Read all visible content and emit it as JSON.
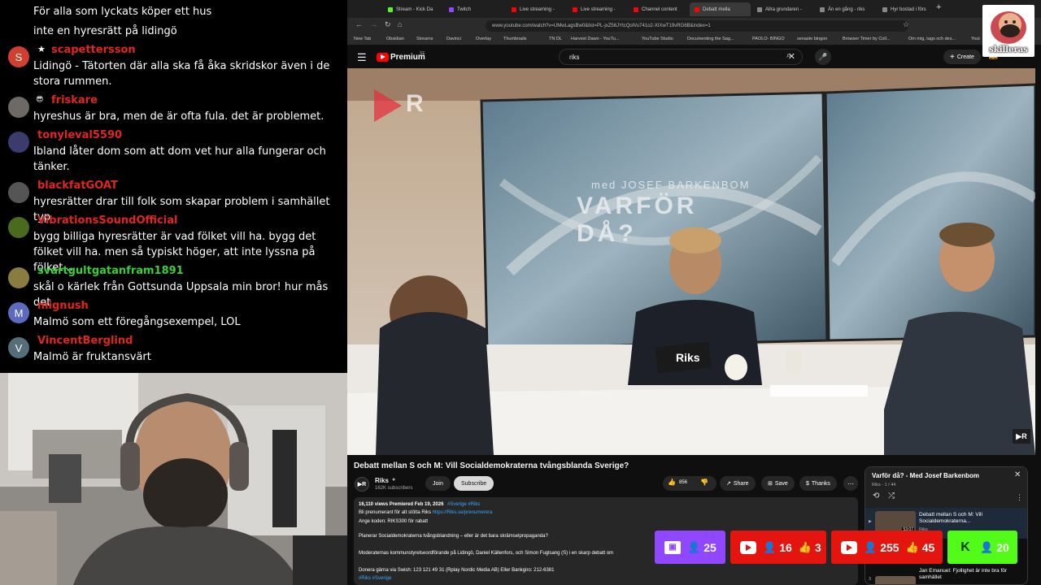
{
  "chat": {
    "messages": [
      {
        "user": "",
        "text": "För alla som lyckats köper ett hus",
        "avatar": ""
      },
      {
        "user": "",
        "text": "inte en hyresrätt på lidingö",
        "avatar": ""
      },
      {
        "user": "scapettersson",
        "text": "Lidingö - Tätorten där alla ska få åka skridskor även i de stora rummen.",
        "avatar": "S",
        "badge": "★",
        "avatar_color": "#d13f2f"
      },
      {
        "user": "friskare",
        "text": "hyreshus är bra, men de är ofta fula. det är problemet.",
        "avatar": "",
        "badge": "😎",
        "avatar_color": "#6d6a66"
      },
      {
        "user": "tonyleval5590",
        "text": "Ibland låter dom som att dom vet hur alla fungerar och tänker.",
        "avatar": "",
        "avatar_color": "#3b3b6e"
      },
      {
        "user": "blackfatGOAT",
        "text": "hyresrätter drar till folk som skapar problem i samhället typ",
        "avatar": "",
        "avatar_color": "#555"
      },
      {
        "user": "VibrationsSoundOfficial",
        "text": "bygg billiga hyresrätter är vad fölket vill ha. bygg det fölket vill ha. men så typiskt höger, att inte lyssna på fölket...",
        "avatar": "",
        "avatar_color": "#4a6b1e"
      },
      {
        "user": "svartgultgatanfram1891",
        "text": "skål o kärlek från Gottsunda Uppsala min bror! hur mås det",
        "avatar": "",
        "avatar_color": "#8a7b3f",
        "green": true
      },
      {
        "user": "mignush",
        "text": "Malmö som ett föregångsexempel, LOL",
        "avatar": "M",
        "avatar_color": "#5c6bc0"
      },
      {
        "user": "VincentBerglind",
        "text": "Malmö är fruktansvärt",
        "avatar": "V",
        "avatar_color": "#546e7a"
      }
    ]
  },
  "browser": {
    "tabs": [
      {
        "label": "Stream - Kick Da",
        "color": "#53fc18"
      },
      {
        "label": "Twitch",
        "color": "#9146ff"
      },
      {
        "label": "Live streaming - ",
        "color": "#ff0000"
      },
      {
        "label": "Live streaming - ",
        "color": "#ff0000"
      },
      {
        "label": "Channel content ",
        "color": "#ff0000"
      },
      {
        "label": "Debatt mella",
        "color": "#ff0000",
        "active": true
      },
      {
        "label": "Allra grundaren - ",
        "color": "#888"
      },
      {
        "label": "Än en gång - riks",
        "color": "#888"
      },
      {
        "label": "Hyr bostad i förs",
        "color": "#888"
      }
    ],
    "url": "www.youtube.com/watch?v=UMwLagsBw0&list=PL-jxZ56JYtcQolVu741o2-XIXwT19vRG6B&index=1",
    "bookmarks": [
      "New Tab",
      "Obsidian",
      "Streams",
      "Davinci",
      "Overlay",
      "Thumbnails",
      "TN DL",
      "Harvest Dawn - YouTu...",
      "YouTube Studio",
      "Documenting the Sag...",
      "PAOLO- BINGO",
      "senaste bingon",
      "Browser Timer by Coll...",
      "Om mig, tags och des...",
      "Yout"
    ],
    "youtube": {
      "brand": "Premium",
      "brand_sup": "SE",
      "search_value": "riks",
      "create_label": "Create"
    }
  },
  "video": {
    "watermark": "R",
    "screen_title_small": "med JOSEF BARKENBOM",
    "screen_title": "VARFÖR DÅ?",
    "desk_sign": "Riks",
    "corner_logo": "▶R"
  },
  "info": {
    "title": "Debatt mellan S och M: Vill Socialdemokraterna tvångsblanda Sverige?",
    "channel": "Riks",
    "subscribers": "162K subscribers",
    "join": "Join",
    "subscribe": "Subscribe",
    "likes": "856",
    "share": "Share",
    "save": "Save",
    "thanks": "Thanks",
    "views": "16,110 views  Premiered Feb 19, 2026",
    "hashtags_top": "#Sverige #Riks",
    "desc1a": "Bli prenumerant för att stötta Riks ",
    "desc1b": "https://Riks.se/prenumerera",
    "desc2": "Ange koden: RIKS300 för rabatt",
    "desc3": "Planerar Socialdemokraterna tvångsblandning – eller är det bara skrämselpropaganda?",
    "desc4": "Moderaternas kommunstyrelseordförande på Lidingö, Daniel Källenfors, och Simon Fuglsang (S) i en skarp debatt om",
    "desc5": "Donera gärna via Swish: 123 121 49 31 (Rplay Nordic Media AB) Eller Bankgiro: 212-6381",
    "hashtags_bottom": "#Riks #Sverige"
  },
  "playlist": {
    "title": "Varför då? - Med Josef Barkenbom",
    "subtitle": "Riks - 1 / 44",
    "item1_title": "Debatt mellan S och M: Vill Socialdemokraterna...",
    "item1_channel": "Riks",
    "item1_duration": "53:07",
    "item2_title": "Jan Emanuel: Fjollighet är inte bra för samhället",
    "item2_index": "3"
  },
  "overlay": {
    "skilleras_label": "skilleras",
    "counters": [
      {
        "platform": "twitch",
        "viewers": "25",
        "color": "#9146ff"
      },
      {
        "platform": "youtube",
        "viewers": "16",
        "likes": "3",
        "color": "#e4150f"
      },
      {
        "platform": "youtube",
        "viewers": "255",
        "likes": "45",
        "color": "#e4150f"
      },
      {
        "platform": "kick",
        "viewers": "20",
        "color": "#53fc18"
      }
    ]
  }
}
